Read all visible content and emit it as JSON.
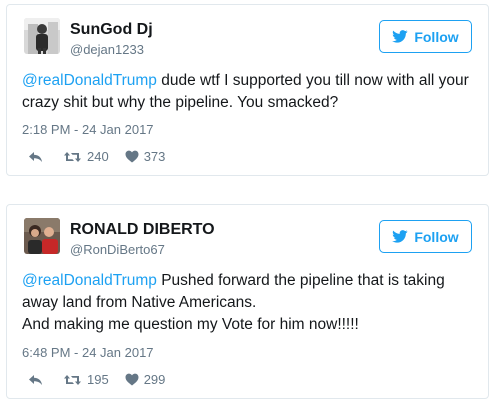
{
  "tweets": [
    {
      "name": "SunGod Dj",
      "handle": "@dejan1233",
      "follow_label": "Follow",
      "mention": "@realDonaldTrump",
      "text": " dude wtf I supported you till now with all your crazy shit but why the pipeline. You smacked?",
      "timestamp": "2:18 PM - 24 Jan 2017",
      "retweets": "240",
      "likes": "373"
    },
    {
      "name": "RONALD DIBERTO",
      "handle": "@RonDiBerto67",
      "follow_label": "Follow",
      "mention": "@realDonaldTrump",
      "text": " Pushed forward the pipeline that is taking away land from Native Americans.",
      "text_line2": "And making me question my Vote for him now!!!!!",
      "timestamp": "6:48 PM - 24 Jan 2017",
      "retweets": "195",
      "likes": "299"
    }
  ],
  "colors": {
    "accent": "#1da1f2",
    "muted": "#657786",
    "border": "#e1e8ed",
    "text": "#14171a"
  },
  "icons": [
    "twitter-bird-icon",
    "reply-icon",
    "retweet-icon",
    "heart-icon"
  ]
}
